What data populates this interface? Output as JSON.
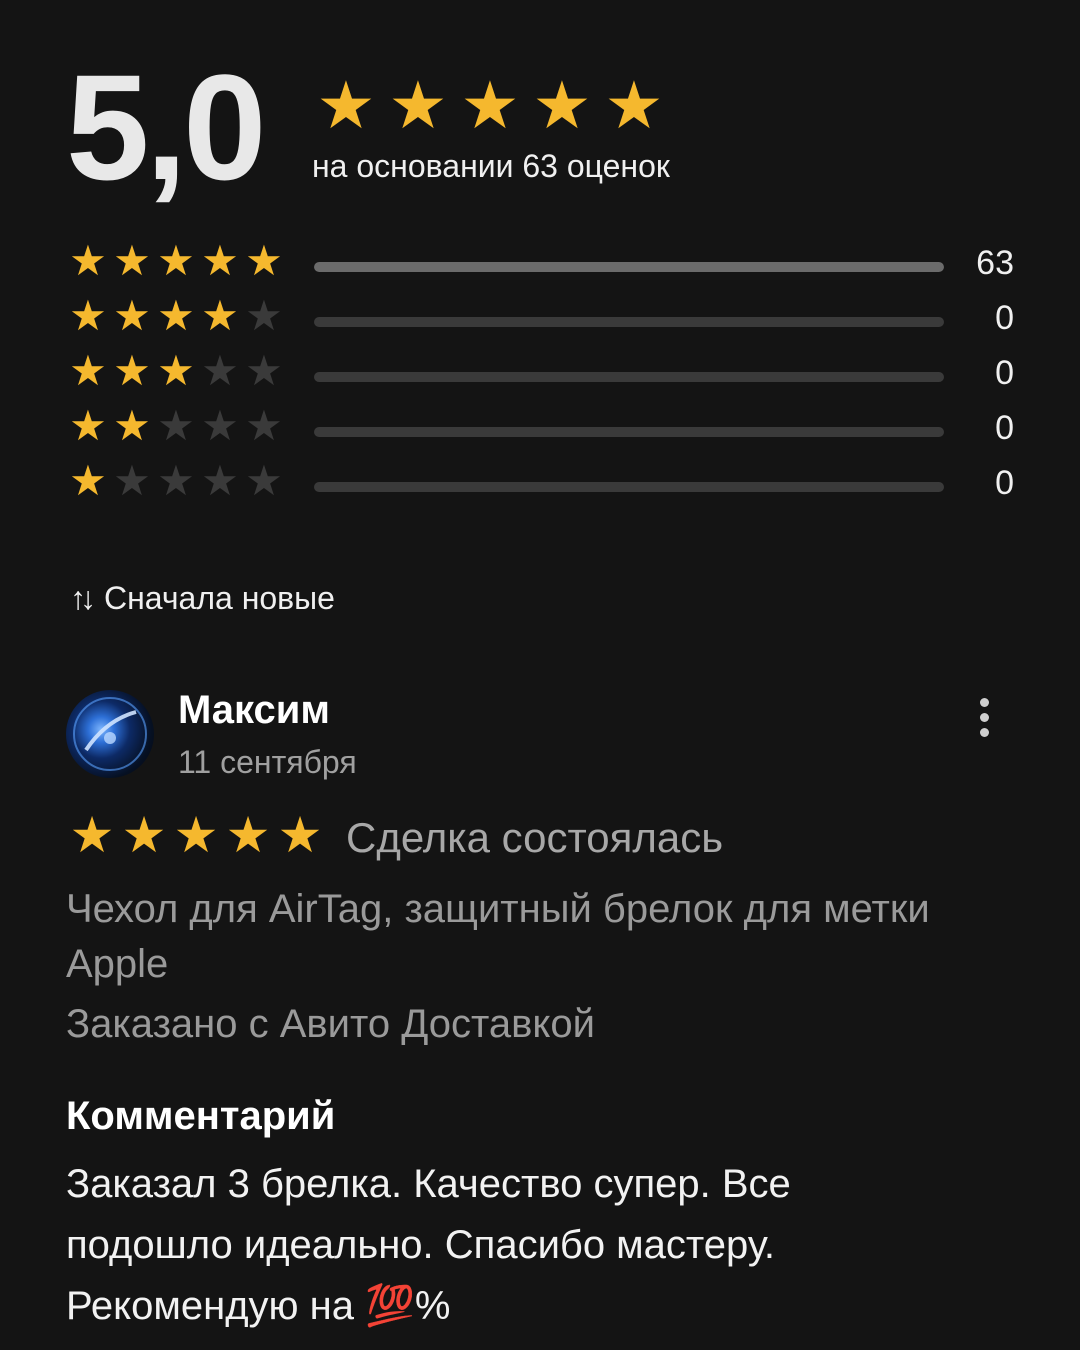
{
  "summary": {
    "rating": "5,0",
    "stars_filled": 5,
    "based_on": "на основании 63 оценок"
  },
  "distribution": [
    {
      "stars": 5,
      "count": "63",
      "fill_fraction": 1.0
    },
    {
      "stars": 4,
      "count": "0",
      "fill_fraction": 0
    },
    {
      "stars": 3,
      "count": "0",
      "fill_fraction": 0
    },
    {
      "stars": 2,
      "count": "0",
      "fill_fraction": 0
    },
    {
      "stars": 1,
      "count": "0",
      "fill_fraction": 0
    }
  ],
  "sort": {
    "icon": "sort-arrows-icon",
    "label": "Сначала новые"
  },
  "review": {
    "name": "Максим",
    "date": "11 сентября",
    "stars": 5,
    "status": "Сделка состоялась",
    "product": "Чехол для AirTag, защитный брелок для метки Apple",
    "order_via": "Заказано с Авито Доставкой",
    "comment_label": "Комментарий",
    "comment": "Заказал 3 брелка. Качество супер. Все подошло идеально. Спасибо мастеру. Рекомендую на 💯%"
  },
  "colors": {
    "background": "#141414",
    "star_active": "#f5b82e",
    "star_inactive": "#3a3a3a",
    "bar_track": "#3a3a3a",
    "bar_fill": "#6b6b6b"
  }
}
